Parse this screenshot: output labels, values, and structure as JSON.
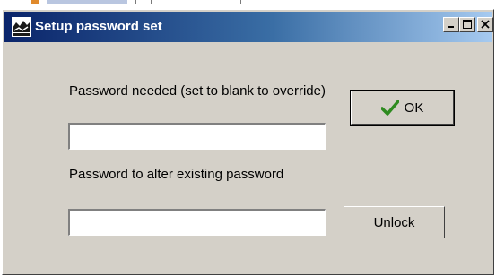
{
  "window": {
    "title": "Setup password set",
    "app_icon": "app-icon",
    "controls": {
      "minimize_icon": "minimize-icon",
      "maximize_icon": "maximize-icon",
      "close_icon": "close-icon"
    }
  },
  "form": {
    "password_needed_label": "Password needed (set to blank to override)",
    "password_needed_value": "",
    "alter_password_label": "Password to alter existing password",
    "alter_password_value": ""
  },
  "buttons": {
    "ok_label": "OK",
    "ok_icon": "checkmark-icon",
    "unlock_label": "Unlock"
  },
  "colors": {
    "title_gradient_start": "#0a246a",
    "title_gradient_end": "#a6caf0",
    "dialog_face": "#d4d0c8",
    "checkmark": "#2e8b20"
  }
}
